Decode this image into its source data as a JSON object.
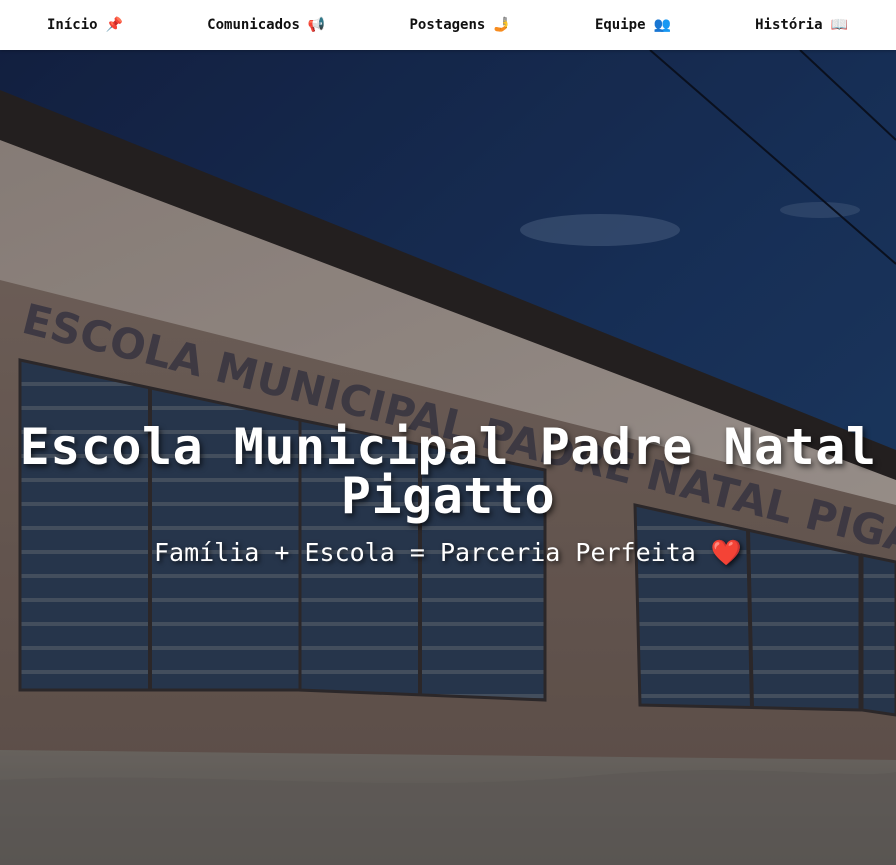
{
  "nav": {
    "items": [
      {
        "label": "Início",
        "emoji": "📌",
        "icon": "pushpin-icon"
      },
      {
        "label": "Comunicados",
        "emoji": "📢",
        "icon": "loudspeaker-icon"
      },
      {
        "label": "Postagens",
        "emoji": "🤳",
        "icon": "selfie-icon"
      },
      {
        "label": "Equipe",
        "emoji": "👥",
        "icon": "people-icon"
      },
      {
        "label": "História",
        "emoji": "📖",
        "icon": "open-book-icon"
      }
    ]
  },
  "hero": {
    "title": "Escola Municipal Padre Natal Pigatto",
    "subtitle": "Família + Escola = Parceria Perfeita",
    "subtitle_emoji": "❤️",
    "background_image": "school-building-photo",
    "wall_lettering": "ESCOLA MUNICIPAL PADRE NATAL PIGATTO"
  },
  "colors": {
    "nav_background": "#ffffff",
    "nav_text": "#111111",
    "hero_text": "#ffffff",
    "sky": "#1d3a6b",
    "wall": "#8a7566",
    "heart": "#e3262e"
  }
}
